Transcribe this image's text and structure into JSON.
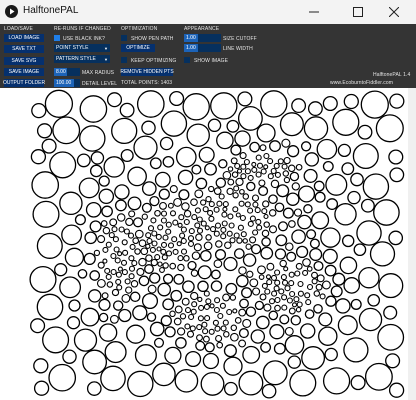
{
  "window": {
    "title": "HalftonePAL",
    "icon": "play-circle-icon",
    "controls": [
      "minimize-icon",
      "maximize-icon",
      "close-icon"
    ]
  },
  "load_save": {
    "header": "LOAD/SAVE",
    "load_image": "LOAD IMAGE",
    "save_txt": "SAVE TXT",
    "save_svg": "SAVE SVG",
    "save_image": "SAVE IMAGE",
    "output_folder": "OUTPUT FOLDER"
  },
  "rerun": {
    "header": "RE-RUNS IF CHANGED",
    "use_black_ink": {
      "label": "USE BLACK INK?",
      "checked": true
    },
    "point_style": "POINT STYLE",
    "pattern_style": "PATTERN STYLE",
    "max_radius": {
      "value": "8.00",
      "label": "MAX RADIUS"
    },
    "detail_level": {
      "value": "100.00",
      "label": "DETAIL LEVEL"
    }
  },
  "optimization": {
    "header": "OPTIMIZATION",
    "show_pen_path": {
      "label": "SHOW PEN PATH",
      "checked": false
    },
    "optimize": "OPTIMIZE",
    "keep_optimizing": {
      "label": "KEEP OPTIMIZING",
      "checked": false
    },
    "remove_hidden": "REMOVE HIDDEN PTS",
    "total_points": "TOTAL POINTS: 1403"
  },
  "appearance": {
    "header": "APPEARANCE",
    "size_cutoff": {
      "value": "1.00",
      "label": "SIZE CUTOFF"
    },
    "line_width": {
      "value": "1.00",
      "label": "LINE WIDTH"
    },
    "show_image": {
      "label": "SHOW IMAGE",
      "checked": false
    }
  },
  "footer": {
    "version": "HalftonePAL 1.4",
    "website": "www.EcoburntoFiddler.com"
  },
  "colors": {
    "control_bg": "#343434",
    "button": "#05306e",
    "accent": "#1f7ee8",
    "canvas": "#ffffff",
    "ink": "#000000"
  },
  "canvas": {
    "description_hidden": true
  }
}
